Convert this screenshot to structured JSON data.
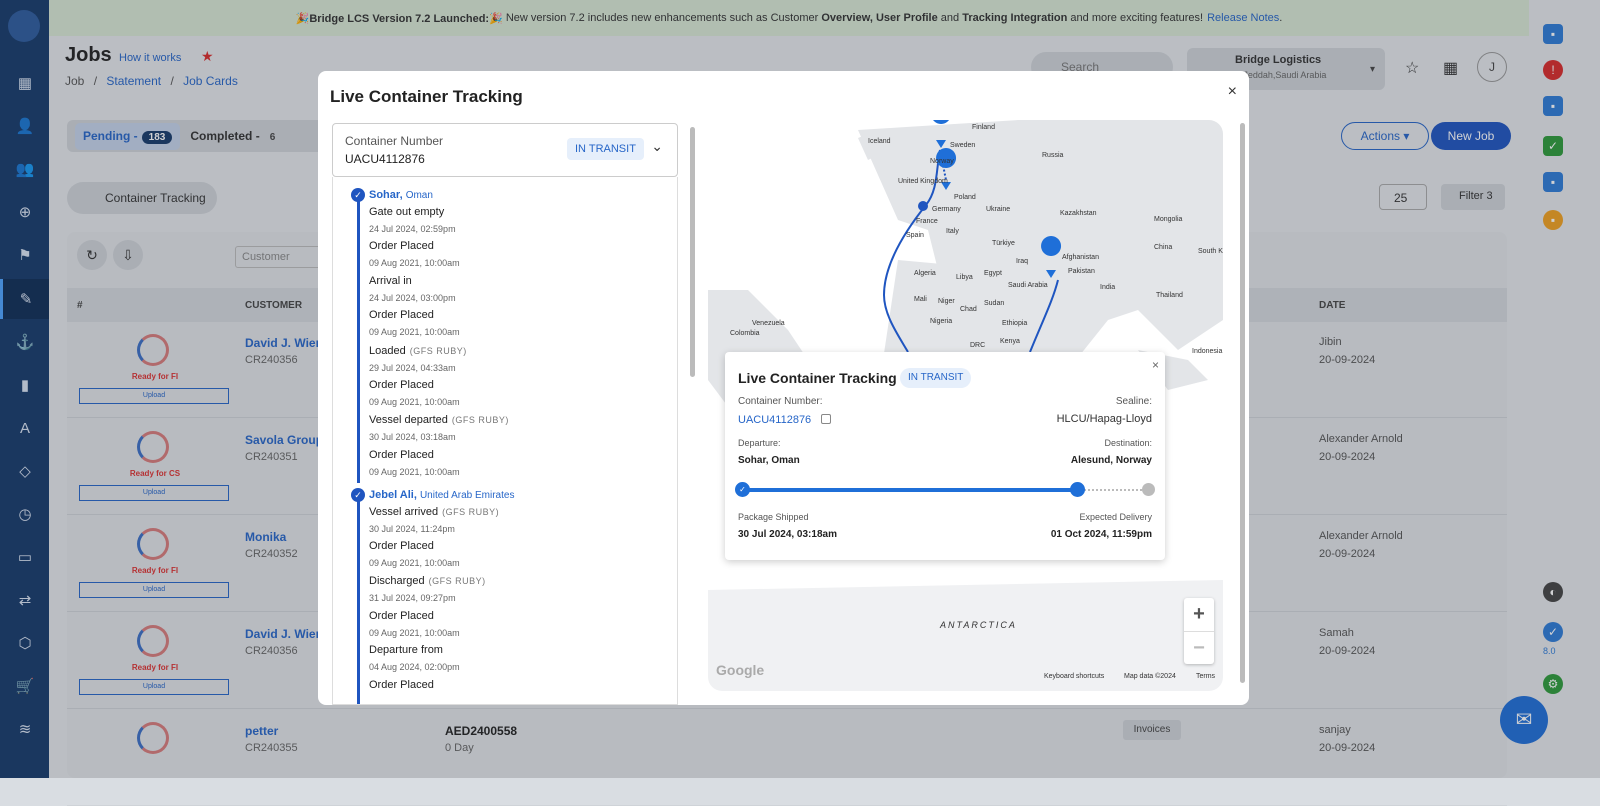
{
  "banner": {
    "launched": "🎉Bridge LCS Version 7.2 Launched:🎉",
    "text_before": "New version 7.2 includes new enhancements such as Customer",
    "overview": "Overview,",
    "user_profile": "User Profile",
    "and": "and",
    "tracking": "Tracking Integration",
    "text_after": "and more exciting features!",
    "release_notes": "Release Notes",
    "dot": "."
  },
  "header": {
    "title": "Jobs",
    "how_it_works": "How it works",
    "breadcrumb": [
      "Job",
      "/",
      "Statement",
      "/",
      "Job Cards"
    ],
    "search_placeholder": "Search",
    "company_name": "Bridge Logistics",
    "company_location": "P Jeddah,Saudi Arabia",
    "avatar": "J"
  },
  "tabs": {
    "pending_label": "Pending -",
    "pending_count": "183",
    "completed_label": "Completed -",
    "completed_count": "6"
  },
  "toolbar": {
    "actions": "Actions",
    "new_job": "New Job",
    "container_tracking": "Container Tracking",
    "page_size": "25",
    "filter": "Filter",
    "filter_count": "3",
    "customer_filter": "Customer"
  },
  "table": {
    "columns": [
      "#",
      "CUSTOMER",
      "DATE"
    ],
    "rows": [
      {
        "status": "Ready for FI",
        "upload": "Upload",
        "customer": "David J. Wiene",
        "id": "CR240356",
        "assignee": "Jibin",
        "date": "20-09-2024"
      },
      {
        "status": "Ready for CS",
        "upload": "Upload",
        "customer": "Savola Group",
        "id": "CR240351",
        "assignee": "Alexander Arnold",
        "date": "20-09-2024"
      },
      {
        "status": "Ready for FI",
        "upload": "Upload",
        "customer": "Monika",
        "id": "CR240352",
        "assignee": "Alexander Arnold",
        "date": "20-09-2024"
      },
      {
        "status": "Ready for FI",
        "upload": "Upload",
        "customer": "David J. Wiene",
        "id": "CR240356",
        "assignee": "Samah",
        "date": "20-09-2024"
      },
      {
        "status": "",
        "upload": "",
        "customer": "petter",
        "id": "CR240355",
        "job_ref": "AED2400558",
        "job_day": "0 Day",
        "invoices": "Invoices",
        "assignee": "sanjay",
        "date": "20-09-2024"
      }
    ]
  },
  "rightbar": {
    "version": "8.0"
  },
  "modal": {
    "title": "Live Container Tracking",
    "container_label": "Container Number",
    "container_number": "UACU4112876",
    "status": "IN TRANSIT",
    "timeline": {
      "stop1": {
        "city": "Sohar,",
        "country": "Oman"
      },
      "stop2": {
        "city": "Jebel Ali,",
        "country": "United Arab Emirates"
      },
      "events": [
        {
          "name": "Gate out empty",
          "vessel": "",
          "time": "24 Jul 2024, 02:59pm"
        },
        {
          "name": "Order Placed",
          "vessel": "",
          "time": "09 Aug 2021, 10:00am"
        },
        {
          "name": "Arrival in",
          "vessel": "",
          "time": "24 Jul 2024, 03:00pm"
        },
        {
          "name": "Order Placed",
          "vessel": "",
          "time": "09 Aug 2021, 10:00am"
        },
        {
          "name": "Loaded",
          "vessel": "(GFS RUBY)",
          "time": "29 Jul 2024, 04:33am"
        },
        {
          "name": "Order Placed",
          "vessel": "",
          "time": "09 Aug 2021, 10:00am"
        },
        {
          "name": "Vessel departed",
          "vessel": "(GFS RUBY)",
          "time": "30 Jul 2024, 03:18am"
        },
        {
          "name": "Order Placed",
          "vessel": "",
          "time": "09 Aug 2021, 10:00am"
        },
        {
          "name": "Vessel arrived",
          "vessel": "(GFS RUBY)",
          "time": "30 Jul 2024, 11:24pm"
        },
        {
          "name": "Order Placed",
          "vessel": "",
          "time": "09 Aug 2021, 10:00am"
        },
        {
          "name": "Discharged",
          "vessel": "(GFS RUBY)",
          "time": "31 Jul 2024, 09:27pm"
        },
        {
          "name": "Order Placed",
          "vessel": "",
          "time": "09 Aug 2021, 10:00am"
        },
        {
          "name": "Departure from",
          "vessel": "",
          "time": "04 Aug 2024, 02:00pm"
        },
        {
          "name": "Order Placed",
          "vessel": "",
          "time": ""
        }
      ]
    },
    "map": {
      "labels": [
        "Finland",
        "Sweden",
        "Iceland",
        "Norway",
        "Russia",
        "United Kingdom",
        "Poland",
        "Germany",
        "Ukraine",
        "France",
        "Kazakhstan",
        "Mongolia",
        "Spain",
        "Italy",
        "Türkiye",
        "China",
        "South K",
        "Afghanistan",
        "Iraq",
        "Pakistan",
        "Algeria",
        "Libya",
        "Egypt",
        "Saudi Arabia",
        "India",
        "Mali",
        "Niger",
        "Sudan",
        "Thailand",
        "Chad",
        "Nigeria",
        "Ethiopia",
        "Venezuela",
        "Colombia",
        "DRC",
        "Kenya",
        "Indonesia",
        "ANTARCTICA"
      ],
      "keyboard": "Keyboard shortcuts",
      "mapdata": "Map data ©2024",
      "terms": "Terms",
      "google": "Google",
      "zoom_in": "+",
      "zoom_out": "−"
    },
    "popup": {
      "title": "Live Container Tracking",
      "status": "IN TRANSIT",
      "container_label": "Container Number:",
      "container_number": "UACU4112876",
      "sealine_label": "Sealine:",
      "sealine": "HLCU/Hapag-Lloyd",
      "departure_label": "Departure:",
      "departure": "Sohar, Oman",
      "destination_label": "Destination:",
      "destination": "Alesund, Norway",
      "progress": 0.83,
      "shipped_label": "Package Shipped",
      "shipped": "30 Jul 2024, 03:18am",
      "expected_label": "Expected Delivery",
      "expected": "01 Oct 2024, 11:59pm"
    }
  }
}
